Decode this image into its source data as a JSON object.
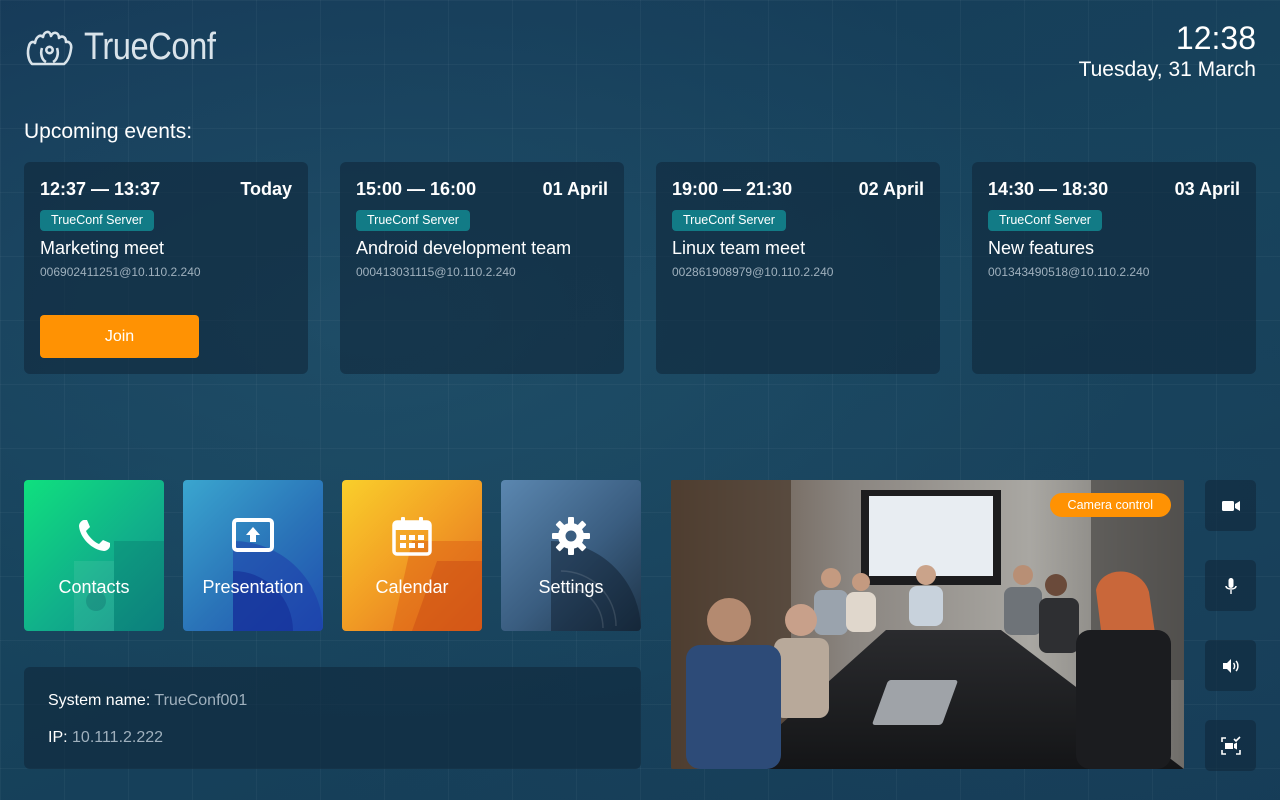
{
  "brand": {
    "name": "TrueConf"
  },
  "clock": {
    "time": "12:38",
    "date": "Tuesday, 31 March"
  },
  "events_title": "Upcoming events:",
  "events": [
    {
      "time": "12:37 — 13:37",
      "day": "Today",
      "server": "TrueConf Server",
      "name": "Marketing meet",
      "address": "006902411251@10.110.2.240",
      "join_label": "Join"
    },
    {
      "time": "15:00 — 16:00",
      "day": "01 April",
      "server": "TrueConf Server",
      "name": "Android development team",
      "address": "000413031115@10.110.2.240"
    },
    {
      "time": "19:00 — 21:30",
      "day": "02 April",
      "server": "TrueConf Server",
      "name": "Linux team meet",
      "address": "002861908979@10.110.2.240"
    },
    {
      "time": "14:30 — 18:30",
      "day": "03 April",
      "server": "TrueConf Server",
      "name": "New features",
      "address": "001343490518@10.110.2.240"
    }
  ],
  "tiles": [
    {
      "label": "Contacts",
      "icon": "phone-icon"
    },
    {
      "label": "Presentation",
      "icon": "presentation-icon"
    },
    {
      "label": "Calendar",
      "icon": "calendar-icon"
    },
    {
      "label": "Settings",
      "icon": "gear-icon"
    }
  ],
  "system": {
    "name_label": "System name:",
    "name_value": "TrueConf001",
    "ip_label": "IP:",
    "ip_value": "10.111.2.222"
  },
  "preview": {
    "camera_control_label": "Camera control"
  },
  "controls": [
    "video-camera-icon",
    "microphone-icon",
    "speaker-icon",
    "screen-share-icon"
  ],
  "colors": {
    "accent": "#ff9203",
    "server_tag": "#127b86",
    "background": "#14344f"
  }
}
